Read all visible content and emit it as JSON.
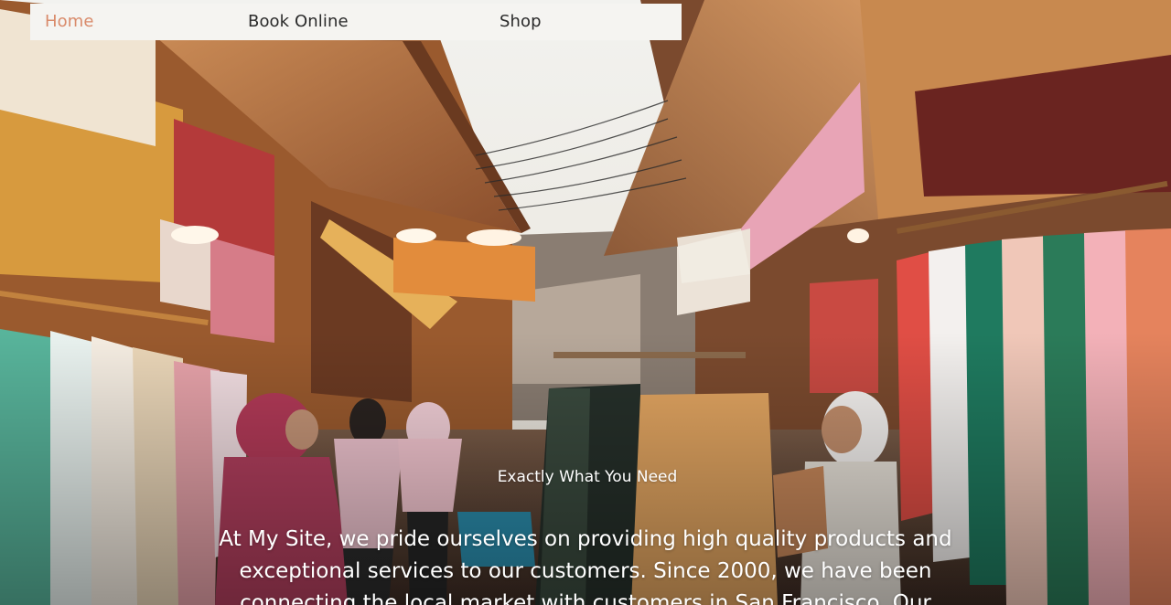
{
  "colors": {
    "accent_bar": "#b2189b",
    "nav_active": "#d98a6a",
    "nav_text": "#2a2a2a",
    "nav_bg": "#f5f4f1",
    "hero_text": "#ffffff"
  },
  "nav": {
    "items": [
      {
        "label": "Home",
        "active": true
      },
      {
        "label": "Book Online",
        "active": false
      },
      {
        "label": "Shop",
        "active": false
      }
    ]
  },
  "hero": {
    "image": "market-street-clothing-stalls",
    "tagline": "Exactly What You Need",
    "intro": "At My Site, we pride ourselves on providing high quality products and exceptional services to our customers. Since 2000, we have been connecting the local market with customers in San Francisco. Our"
  }
}
